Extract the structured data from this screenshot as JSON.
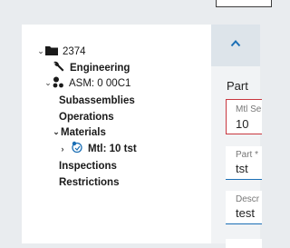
{
  "tree": {
    "root_label": "2374",
    "engineering_label": "Engineering",
    "asm_label": "ASM: 0 00C1",
    "subassemblies_label": "Subassemblies",
    "operations_label": "Operations",
    "materials_label": "Materials",
    "mtl_label": "Mtl: 10 tst",
    "inspections_label": "Inspections",
    "restrictions_label": "Restrictions"
  },
  "detail": {
    "section_title": "Part",
    "mtl_seq": {
      "label": "Mtl Se",
      "value": "10"
    },
    "part": {
      "label": "Part *",
      "value": "tst"
    },
    "description": {
      "label": "Descr",
      "value": "test"
    }
  },
  "colors": {
    "error_border": "#c8373f",
    "focus_underline": "#1b6fb5",
    "mtl_icon": "#1b6fb5"
  }
}
